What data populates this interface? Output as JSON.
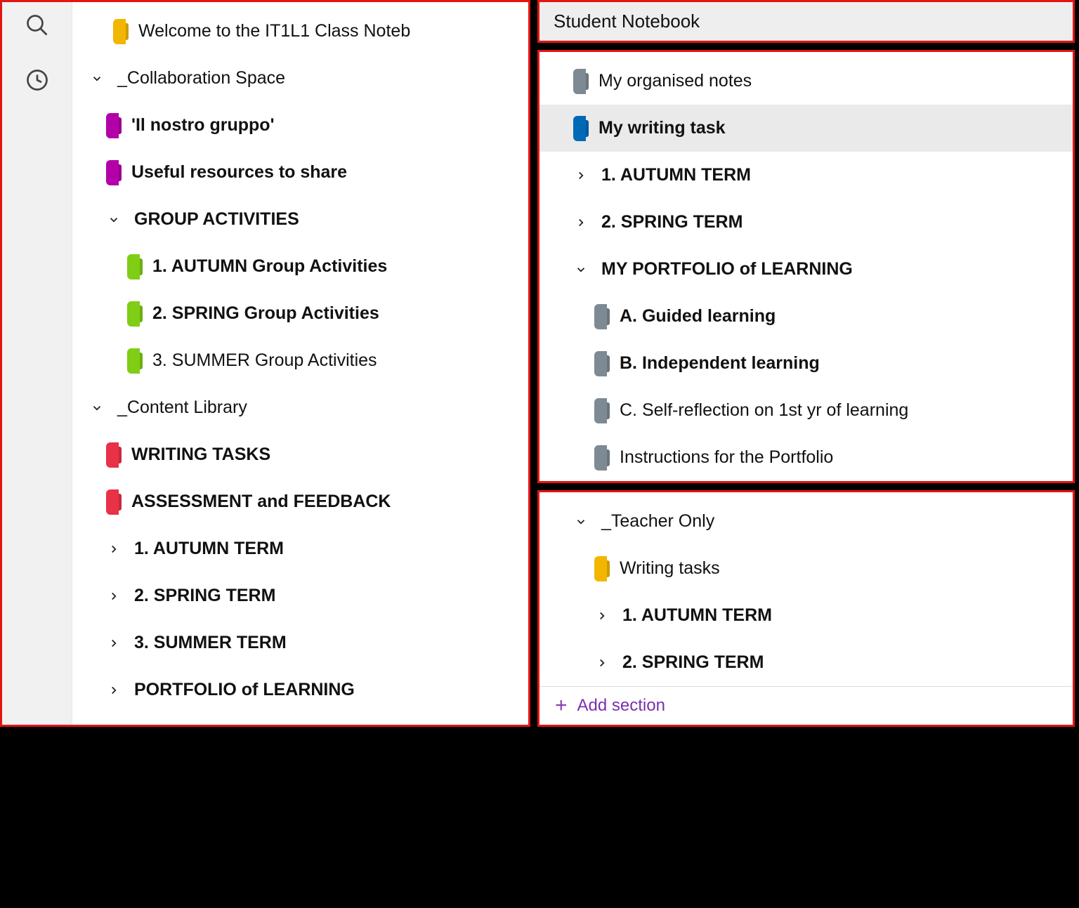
{
  "left": {
    "welcome": "Welcome to the IT1L1 Class Noteb",
    "collab": "_Collaboration Space",
    "collab_items": {
      "gruppo": "'Il nostro gruppo'",
      "resources": "Useful resources to share",
      "group_act": "GROUP ACTIVITIES",
      "ga1": "1. AUTUMN Group Activities",
      "ga2": "2. SPRING Group Activities",
      "ga3": "3. SUMMER Group Activities"
    },
    "content_lib": "_Content Library",
    "cl_items": {
      "writing": "WRITING TASKS",
      "assess": "ASSESSMENT and FEEDBACK",
      "t1": "1. AUTUMN TERM",
      "t2": "2. SPRING TERM",
      "t3": "3. SUMMER TERM",
      "portfolio": "PORTFOLIO of LEARNING"
    }
  },
  "student": {
    "title": "Student Notebook",
    "notes": "My organised notes",
    "writing": "My writing task",
    "t1": "1. AUTUMN TERM",
    "t2": "2. SPRING TERM",
    "portfolio": "MY PORTFOLIO of LEARNING",
    "pa": "A. Guided learning",
    "pb": "B. Independent learning",
    "pc": "C. Self-reflection on 1st yr of learning",
    "pd": "Instructions for the Portfolio"
  },
  "teacher": {
    "title": "_Teacher Only",
    "writing": "Writing tasks",
    "t1": "1. AUTUMN TERM",
    "t2": "2. SPRING TERM",
    "add": "Add section"
  },
  "colors": {
    "yellow": "#f2b600",
    "magenta": "#b400a8",
    "green": "#7fce15",
    "red": "#e93148",
    "grey": "#7e8a93",
    "blue": "#0069b5",
    "accent_purple": "#7a2fb0"
  }
}
